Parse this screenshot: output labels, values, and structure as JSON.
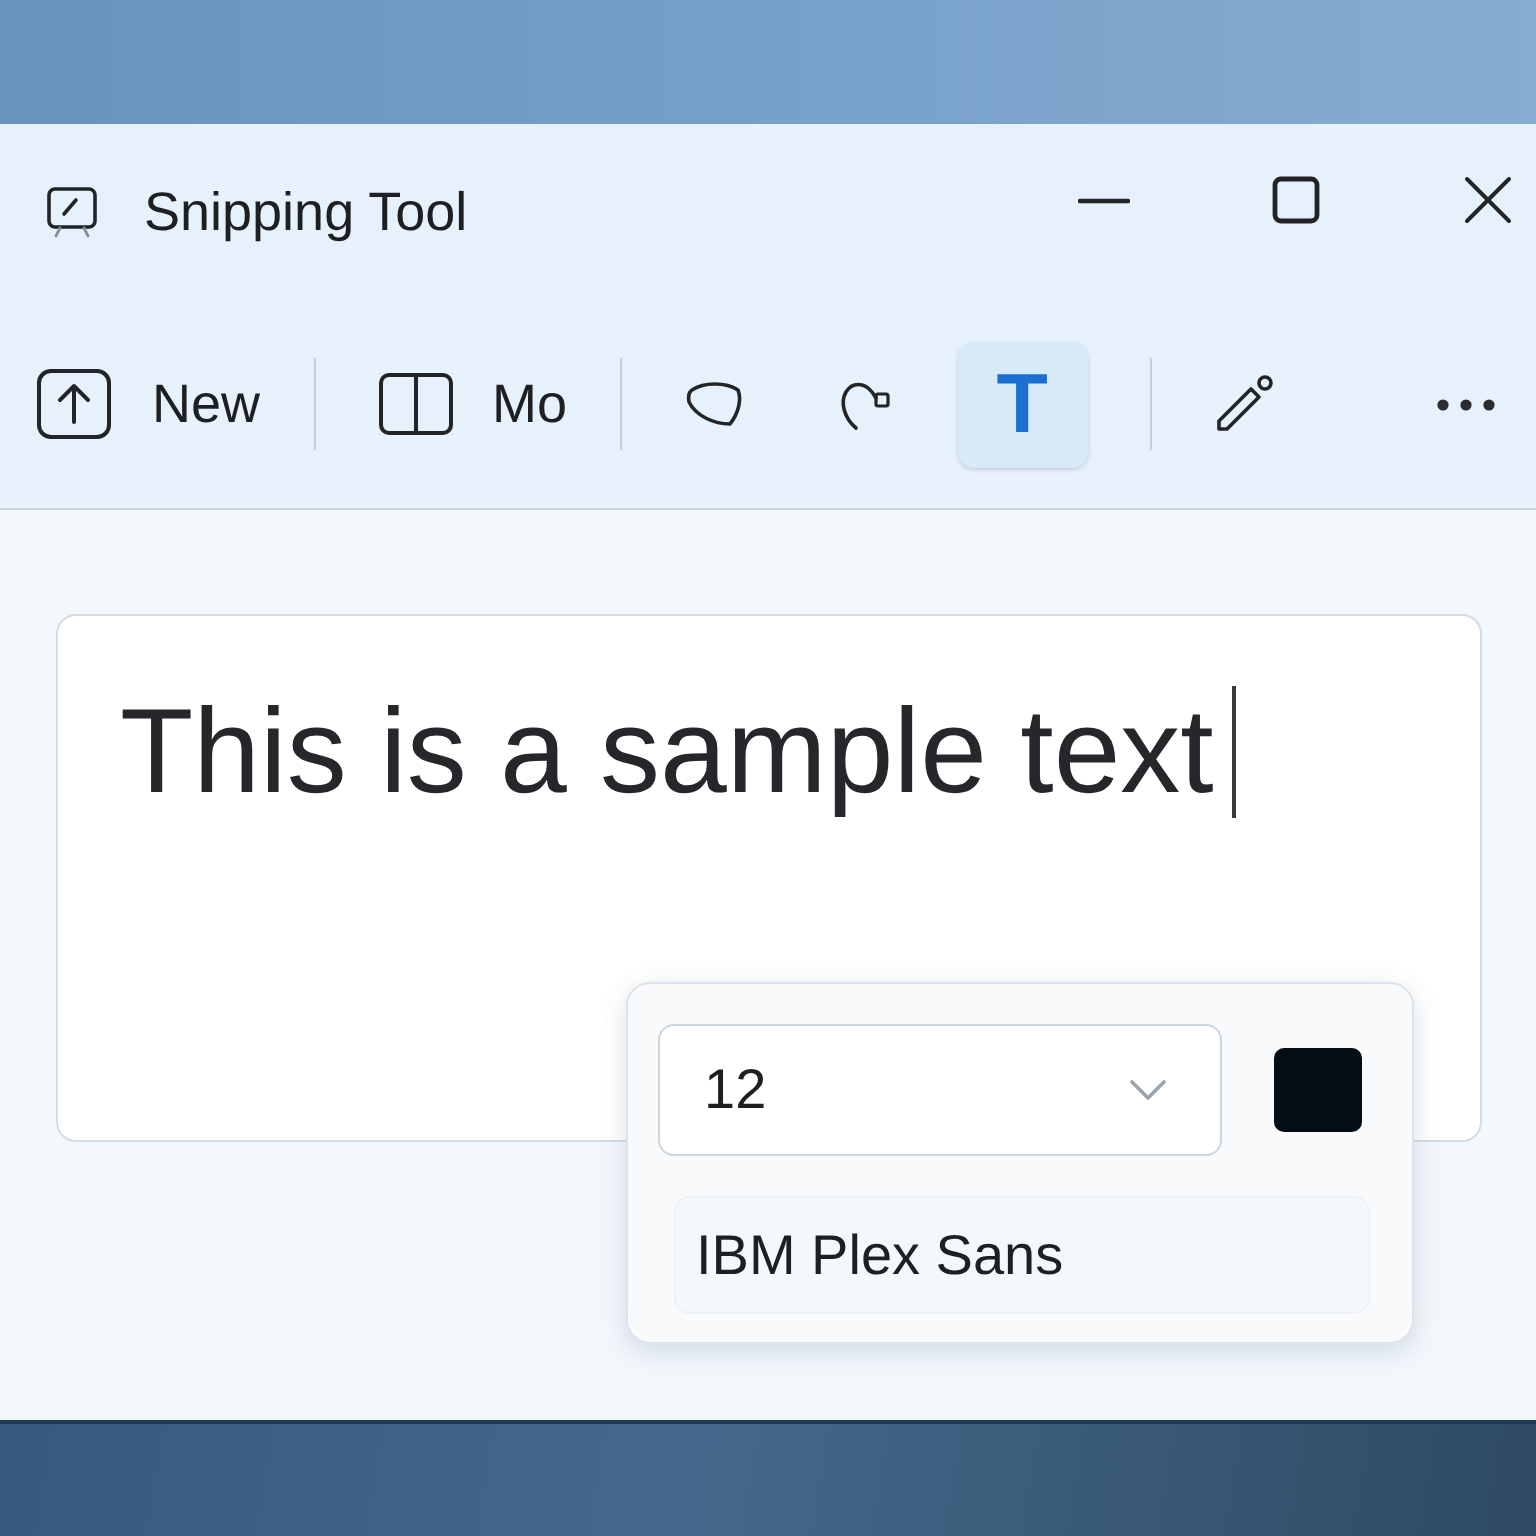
{
  "window": {
    "title": "Snipping Tool"
  },
  "toolbar": {
    "items": [
      {
        "kind": "new",
        "label": "New"
      },
      {
        "kind": "separator"
      },
      {
        "kind": "mode",
        "label": "Mo"
      },
      {
        "kind": "separator"
      },
      {
        "kind": "freeform",
        "selected": false
      },
      {
        "kind": "lasso",
        "selected": false
      },
      {
        "kind": "text",
        "glyph": "T",
        "selected": true
      },
      {
        "kind": "separator"
      },
      {
        "kind": "pen",
        "selected": false
      },
      {
        "kind": "more"
      }
    ]
  },
  "canvas": {
    "text": "This is a sample text",
    "caret": true
  },
  "text_options": {
    "font_size": "12",
    "color": "#050d14",
    "font": "IBM Plex Sans"
  }
}
